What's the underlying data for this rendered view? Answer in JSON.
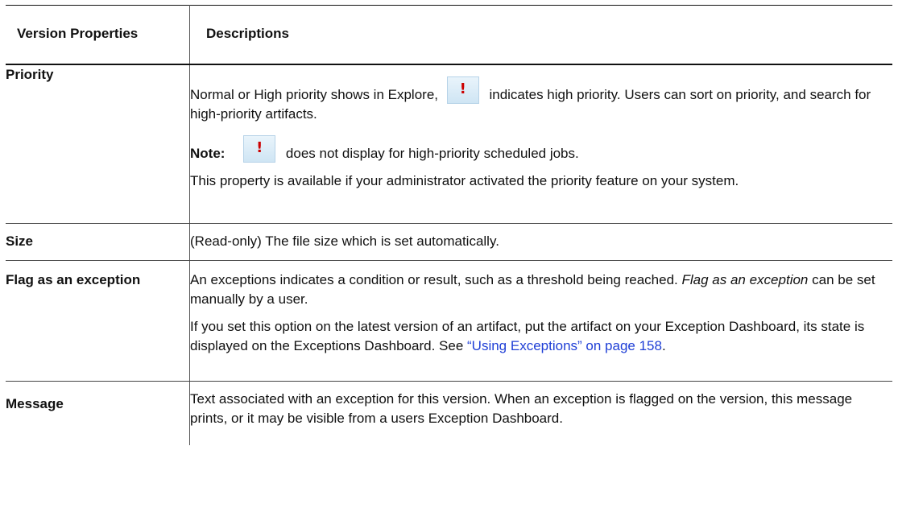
{
  "headers": {
    "property": "Version Properties",
    "description": "Descriptions"
  },
  "rows": {
    "priority": {
      "property": "Priority",
      "p1_before_icon": "Normal or High priority shows in Explore,",
      "p1_after_icon": "indicates high priority. Users can sort on priority, and search for high-priority artifacts.",
      "note_label": "Note:",
      "note_text": "does not display for high-priority scheduled jobs.",
      "p3": "This property is available if your administrator activated the priority feature on your system."
    },
    "size": {
      "property": "Size",
      "p1": "(Read-only) The file size which is set automatically."
    },
    "flag": {
      "property": "Flag as an exception",
      "p1_before_em": "An exceptions indicates a condition or result, such as a threshold being reached.",
      "p1_em": "Flag as an exception",
      "p1_after_em": "can be set manually by a user.",
      "p2_text": "If you set this option on the latest version of an artifact, put the artifact on your Exception Dashboard, its state is displayed on the Exceptions Dashboard. See",
      "p2_link": "“Using Exceptions” on page 158",
      "p2_end": "."
    },
    "message": {
      "property": "Message",
      "p1": "Text associated with an exception for this version. When an exception is flagged on the version, this message prints, or it may be visible from a users Exception Dashboard."
    }
  },
  "icons": {
    "priority_icon": "high-priority-exclamation-icon",
    "priority_icon_glyph": "!",
    "accent_color": "#cc0000",
    "link_color": "#1f3fd6"
  }
}
